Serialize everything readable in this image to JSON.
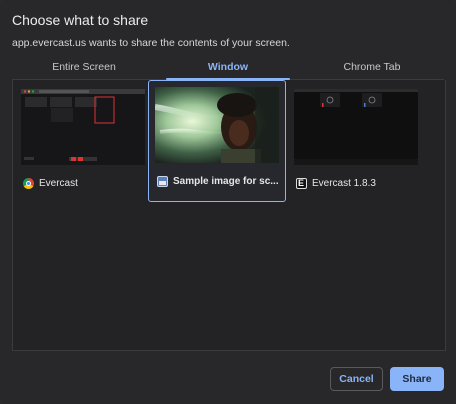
{
  "dialog": {
    "title": "Choose what to share",
    "subtitle": "app.evercast.us wants to share the contents of your screen."
  },
  "tabs": [
    {
      "label": "Entire Screen",
      "active": false
    },
    {
      "label": "Window",
      "active": true
    },
    {
      "label": "Chrome Tab",
      "active": false
    }
  ],
  "sources": [
    {
      "label": "Evercast",
      "icon": "chrome-icon",
      "selected": false
    },
    {
      "label": "Sample image for sc...",
      "icon": "image-preview-icon",
      "selected": true
    },
    {
      "label": "Evercast 1.8.3",
      "icon": "evercast-icon",
      "selected": false
    }
  ],
  "buttons": {
    "cancel": "Cancel",
    "share": "Share"
  },
  "colors": {
    "accent": "#8ab4f8",
    "background": "#28282a"
  }
}
